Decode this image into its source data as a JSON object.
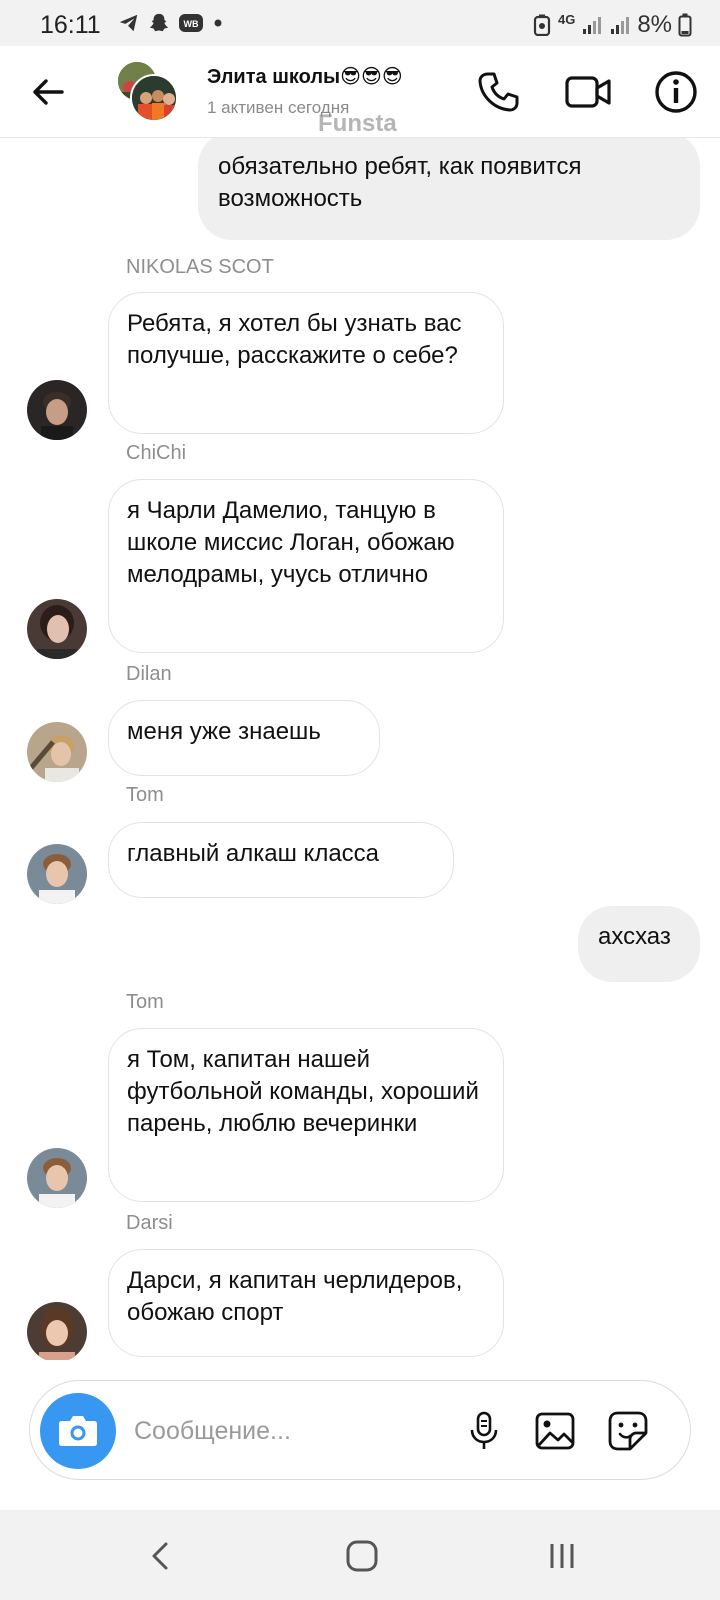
{
  "status_bar": {
    "time": "16:11",
    "network": "4G",
    "battery": "8%",
    "left_icons": [
      "telegram-icon",
      "snapchat-icon",
      "wb-app-icon",
      "dot-icon"
    ]
  },
  "header": {
    "title": "Элита школы😎😎😎",
    "subtitle": "1 активен сегодня",
    "watermark": "Funsta"
  },
  "messages": [
    {
      "id": "m1",
      "direction": "out",
      "text": "обязательно ребят, как появится возможность"
    },
    {
      "id": "m2",
      "direction": "in",
      "sender": "NIKOLAS SCOT",
      "text": "Ребята, я хотел бы узнать вас получше, расскажите о себе?"
    },
    {
      "id": "m3",
      "direction": "in",
      "sender": "ChiChi",
      "text": "я Чарли Дамелио, танцую в школе миссис Логан, обожаю мелодрамы, учусь отлично"
    },
    {
      "id": "m4",
      "direction": "in",
      "sender": "Dilan",
      "text": "меня уже знаешь"
    },
    {
      "id": "m5",
      "direction": "in",
      "sender": "Tom",
      "text": "главный алкаш класса"
    },
    {
      "id": "m6",
      "direction": "out",
      "text": "ахсхаз"
    },
    {
      "id": "m7",
      "direction": "in",
      "sender": "Tom",
      "text": "я Том, капитан нашей футбольной команды, хороший парень, люблю вечеринки"
    },
    {
      "id": "m8",
      "direction": "in",
      "sender": "Darsi",
      "text": "Дарси, я капитан черлидеров, обожаю спорт"
    }
  ],
  "composer": {
    "placeholder": "Сообщение..."
  },
  "colors": {
    "accent": "#3897f0",
    "outgoing_bubble": "#efefef",
    "incoming_border": "#e3e3e3",
    "sender_name": "#8e8e8e"
  }
}
